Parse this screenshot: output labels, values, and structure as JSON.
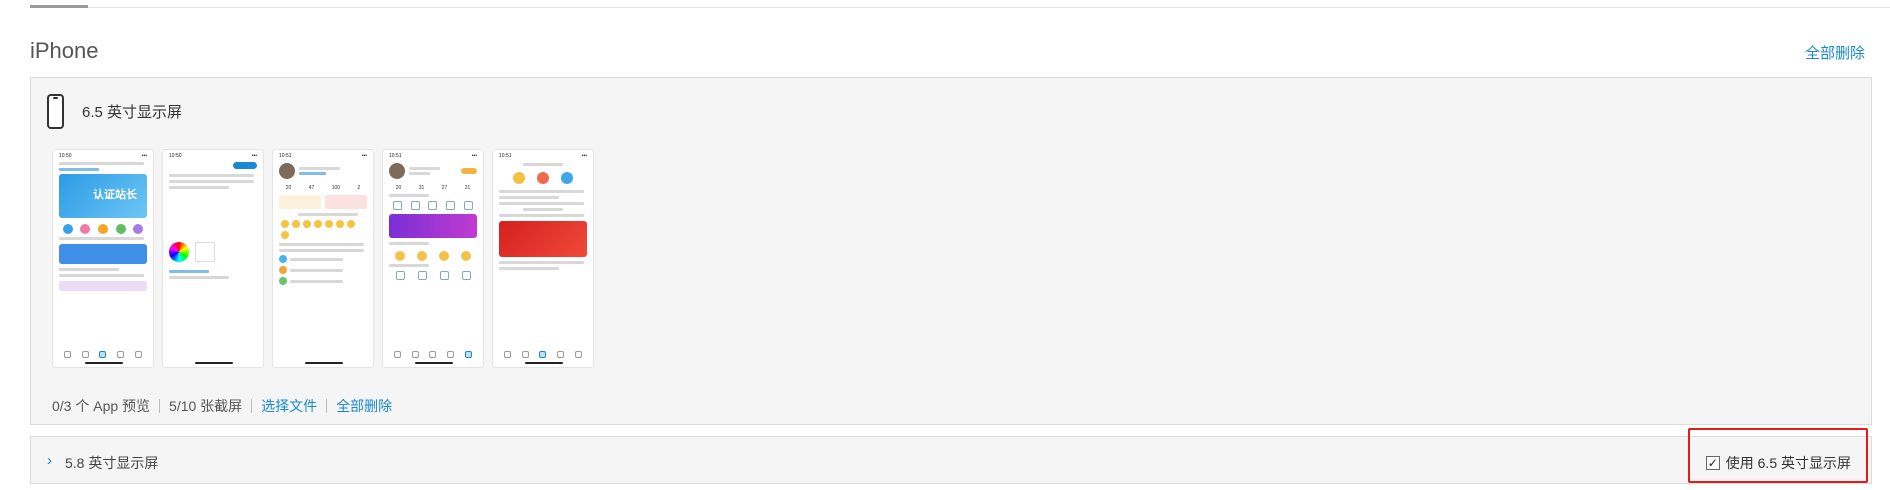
{
  "section": {
    "title": "iPhone",
    "delete_all": "全部删除"
  },
  "display_65": {
    "title": "6.5 英寸显示屏",
    "screenshots": [
      {
        "label": "screenshot-1"
      },
      {
        "label": "screenshot-2"
      },
      {
        "label": "screenshot-3"
      },
      {
        "label": "screenshot-4"
      },
      {
        "label": "screenshot-5"
      }
    ],
    "app_preview_count": "0/3 个 App 预览",
    "screenshot_count": "5/10 张截屏",
    "choose_file": "选择文件",
    "delete_all": "全部删除"
  },
  "display_58": {
    "title": "5.8 英寸显示屏",
    "use_65_label": "使用 6.5 英寸显示屏",
    "use_65_checked": true
  },
  "colors": {
    "link": "#1a88d4",
    "highlight": "#e31b1b",
    "panel_bg": "#f5f5f5"
  },
  "icons": {
    "phone": "phone-outline-icon",
    "chevron": "chevron-right-icon",
    "check": "check-icon"
  },
  "thumbs": {
    "banner_text": "认证站长",
    "s3_stats": [
      "20",
      "47",
      "100",
      "2"
    ],
    "s4_stats": [
      "20",
      "31",
      "27",
      "21"
    ]
  }
}
